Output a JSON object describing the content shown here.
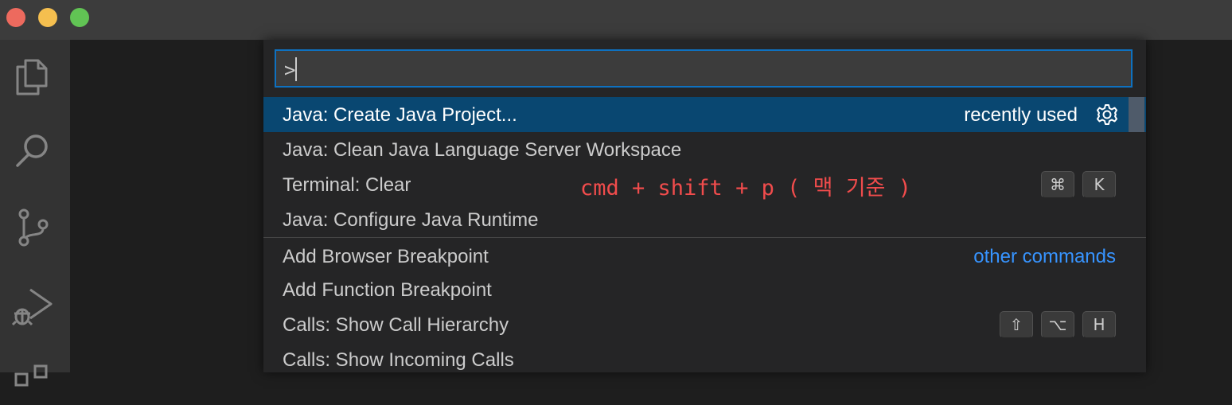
{
  "palette": {
    "input_value": ">",
    "groups": {
      "recent": [
        {
          "label": "Java: Create Java Project...",
          "meta": "recently used"
        },
        {
          "label": "Java: Clean Java Language Server Workspace"
        },
        {
          "label": "Terminal: Clear",
          "keys": [
            "⌘",
            "K"
          ]
        },
        {
          "label": "Java: Configure Java Runtime"
        }
      ],
      "other": [
        {
          "label": "Add Browser Breakpoint",
          "meta": "other commands"
        },
        {
          "label": "Add Function Breakpoint"
        },
        {
          "label": "Calls: Show Call Hierarchy",
          "keys": [
            "⇧",
            "⌥",
            "H"
          ]
        },
        {
          "label": "Calls: Show Incoming Calls"
        }
      ]
    }
  },
  "annotation": "cmd + shift + p ( 맥 기준 )",
  "activity_bar": {
    "icons": [
      "files-icon",
      "search-icon",
      "source-control-icon",
      "run-debug-icon",
      "extensions-icon"
    ]
  },
  "colors": {
    "selection": "#094771",
    "accent_link": "#3794ff",
    "annotation": "#f14c4c",
    "focus_border": "#0e71c0"
  }
}
